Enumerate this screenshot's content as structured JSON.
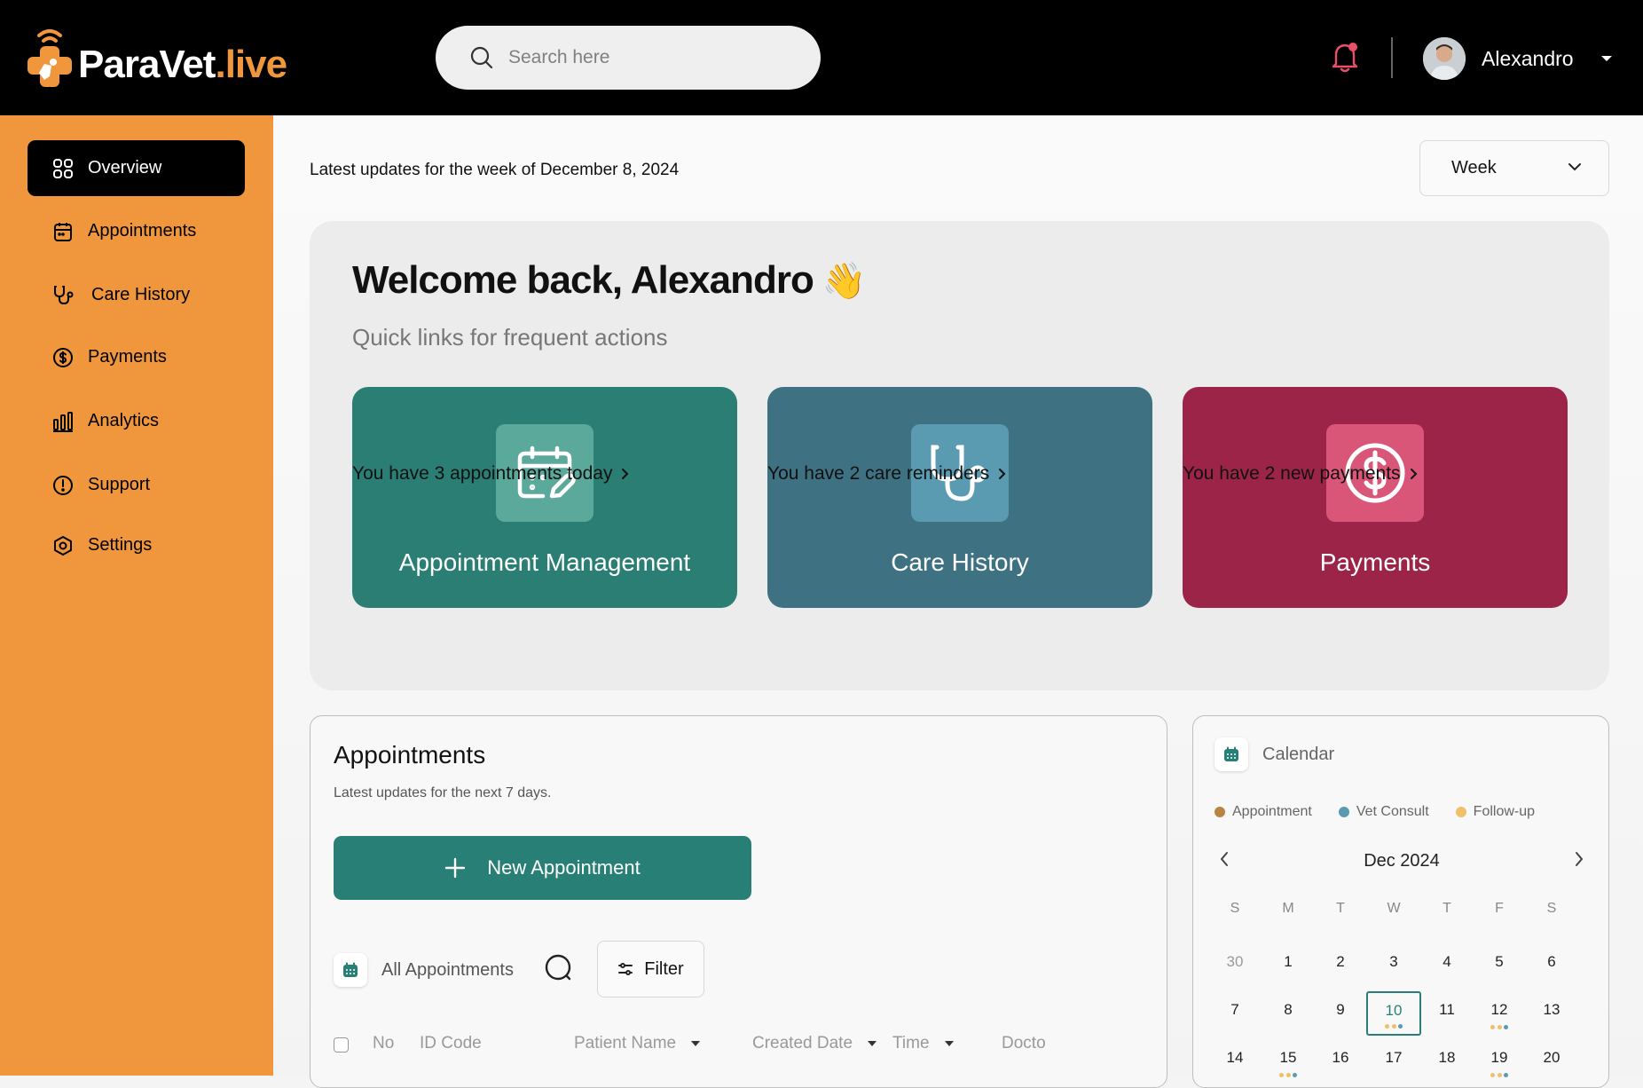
{
  "brand": {
    "name_part1": "ParaVet",
    "name_part2": ".live"
  },
  "search": {
    "placeholder": "Search here"
  },
  "user": {
    "name": "Alexandro"
  },
  "sidebar": {
    "items": [
      {
        "label": "Overview",
        "icon": "grid-icon",
        "active": true
      },
      {
        "label": "Appointments",
        "icon": "calendar-icon"
      },
      {
        "label": "Care History",
        "icon": "stethoscope-icon"
      },
      {
        "label": "Payments",
        "icon": "dollar-icon"
      },
      {
        "label": "Analytics",
        "icon": "bar-chart-icon"
      },
      {
        "label": "Support",
        "icon": "alert-circle-icon"
      },
      {
        "label": "Settings",
        "icon": "settings-icon"
      }
    ]
  },
  "header": {
    "week_text": "Latest updates for the week of December 8, 2024",
    "period_select": "Week"
  },
  "hero": {
    "title": "Welcome back, Alexandro",
    "emoji": "👋",
    "subtitle": "Quick links for frequent actions",
    "cards": [
      {
        "label": "Appointment Management",
        "link": "You have 3 appointments today",
        "color": "#2a7e74",
        "icon_bg": "#5aa99b",
        "icon": "calendar-edit-icon"
      },
      {
        "label": "Care History",
        "link": "You have 2 care reminders",
        "color": "#3e7283",
        "icon_bg": "#5b9bb2",
        "icon": "stethoscope-icon"
      },
      {
        "label": "Payments",
        "link": "You have 2 new payments",
        "color": "#9b2448",
        "icon_bg": "#d95678",
        "icon": "dollar-icon"
      }
    ]
  },
  "appointments": {
    "title": "Appointments",
    "subtitle": "Latest updates for the next 7 days.",
    "new_button": "New Appointment",
    "all_label": "All Appointments",
    "filter_label": "Filter",
    "columns": [
      "No",
      "ID Code",
      "Patient Name",
      "Created Date",
      "Time",
      "Docto"
    ]
  },
  "calendar": {
    "title": "Calendar",
    "legend": [
      {
        "label": "Appointment",
        "color": "#b98442"
      },
      {
        "label": "Vet Consult",
        "color": "#5b9bb2"
      },
      {
        "label": "Follow-up",
        "color": "#f0c06a"
      }
    ],
    "month": "Dec 2024",
    "weekdays": [
      "S",
      "M",
      "T",
      "W",
      "T",
      "F",
      "S"
    ],
    "weeks": [
      [
        "30",
        "1",
        "2",
        "3",
        "4",
        "5",
        "6"
      ],
      [
        "7",
        "8",
        "9",
        "10",
        "11",
        "12",
        "13"
      ],
      [
        "14",
        "15",
        "16",
        "17",
        "18",
        "19",
        "20"
      ]
    ],
    "today": "10",
    "event_days": {
      "10": [
        "#f0c06a",
        "#f0c06a",
        "#5b9bb2"
      ],
      "12": [
        "#f0c06a",
        "#f0c06a",
        "#5b9bb2"
      ],
      "15": [
        "#f0c06a",
        "#f0c06a",
        "#5b9bb2"
      ],
      "19": [
        "#f0c06a",
        "#f0c06a",
        "#5b9bb2"
      ]
    }
  }
}
